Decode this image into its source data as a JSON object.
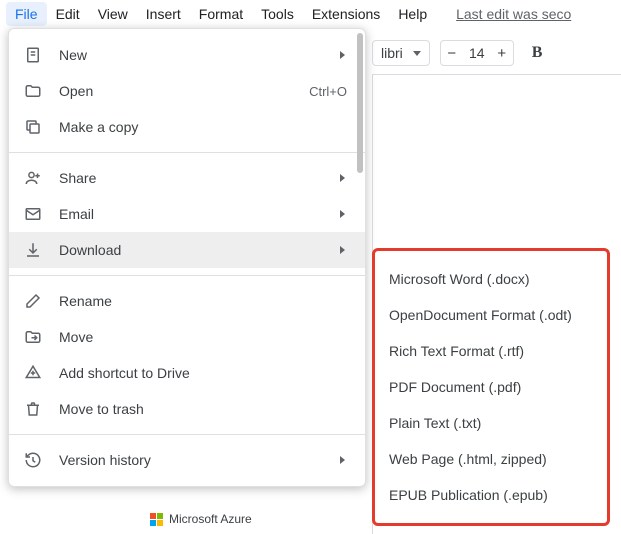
{
  "menubar": {
    "items": [
      "File",
      "Edit",
      "View",
      "Insert",
      "Format",
      "Tools",
      "Extensions",
      "Help"
    ],
    "active_index": 0,
    "last_edit": "Last edit was seco"
  },
  "toolbar": {
    "font_name": "libri",
    "font_size": "14",
    "bold_label": "B"
  },
  "file_menu": {
    "groups": [
      [
        {
          "icon": "file-plus-icon",
          "label": "New",
          "submenu": true
        },
        {
          "icon": "folder-open-icon",
          "label": "Open",
          "shortcut": "Ctrl+O"
        },
        {
          "icon": "copy-icon",
          "label": "Make a copy"
        }
      ],
      [
        {
          "icon": "person-add-icon",
          "label": "Share",
          "submenu": true
        },
        {
          "icon": "mail-icon",
          "label": "Email",
          "submenu": true
        },
        {
          "icon": "download-icon",
          "label": "Download",
          "submenu": true,
          "hover": true
        }
      ],
      [
        {
          "icon": "pencil-icon",
          "label": "Rename"
        },
        {
          "icon": "folder-move-icon",
          "label": "Move"
        },
        {
          "icon": "drive-add-icon",
          "label": "Add shortcut to Drive"
        },
        {
          "icon": "trash-icon",
          "label": "Move to trash"
        }
      ],
      [
        {
          "icon": "history-icon",
          "label": "Version history",
          "submenu": true
        }
      ]
    ]
  },
  "download_submenu": [
    "Microsoft Word (.docx)",
    "OpenDocument Format (.odt)",
    "Rich Text Format (.rtf)",
    "PDF Document (.pdf)",
    "Plain Text (.txt)",
    "Web Page (.html, zipped)",
    "EPUB Publication (.epub)"
  ],
  "taskbar": {
    "azure_label": "Microsoft Azure"
  }
}
